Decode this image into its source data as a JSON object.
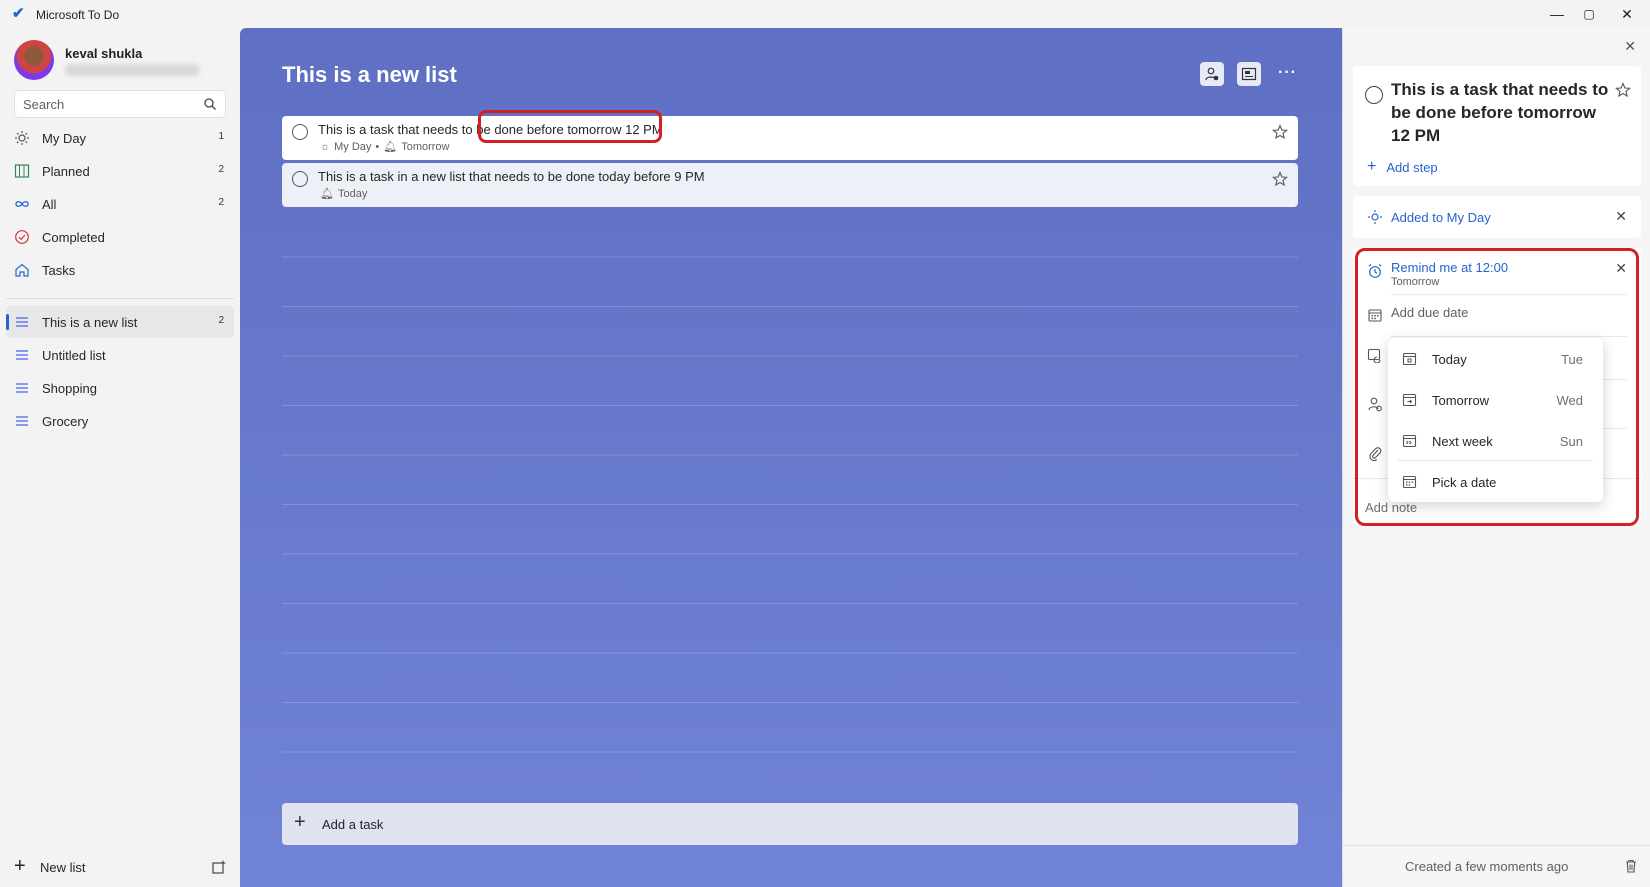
{
  "window": {
    "title": "Microsoft To Do",
    "minimize": "—",
    "maximize": "▢",
    "close": "✕"
  },
  "sidebar": {
    "user_name": "keval shukla",
    "search_placeholder": "Search",
    "items": [
      {
        "label": "My Day",
        "count": "1",
        "icon": "sun-icon"
      },
      {
        "label": "Planned",
        "count": "2",
        "icon": "calendar-grid-icon"
      },
      {
        "label": "All",
        "count": "2",
        "icon": "infinity-icon"
      },
      {
        "label": "Completed",
        "count": "",
        "icon": "check-circle-icon"
      },
      {
        "label": "Tasks",
        "count": "",
        "icon": "home-icon"
      },
      {
        "label": "This is a new list",
        "count": "2",
        "icon": "list-icon",
        "active": true
      },
      {
        "label": "Untitled list",
        "count": "",
        "icon": "list-icon"
      },
      {
        "label": "Shopping",
        "count": "",
        "icon": "list-icon"
      },
      {
        "label": "Grocery",
        "count": "",
        "icon": "list-icon"
      }
    ],
    "new_list_label": "New list"
  },
  "main": {
    "title": "This is a new list",
    "more": "···",
    "tasks": [
      {
        "title": "This is a task that needs to be done before tomorrow 12 PM",
        "meta_myday": "My Day",
        "meta_sep": "•",
        "meta_reminder": "Tomorrow"
      },
      {
        "title": "This is a task in a new list that needs to be done today before 9 PM",
        "meta_reminder": "Today"
      }
    ],
    "add_task_label": "Add a task"
  },
  "detail": {
    "close": "✕",
    "task_title": "This is a task that needs to be done before tomorrow 12 PM",
    "add_step": "Add step",
    "added_to_my_day": "Added to My Day",
    "reminder_title": "Remind me at 12:00",
    "reminder_sub": "Tomorrow",
    "add_due_date": "Add due date",
    "add_note": "Add note",
    "created": "Created a few moments ago",
    "due_menu": [
      {
        "label": "Today",
        "day": "Tue"
      },
      {
        "label": "Tomorrow",
        "day": "Wed"
      },
      {
        "label": "Next week",
        "day": "Sun"
      },
      {
        "label": "Pick a date",
        "day": ""
      }
    ]
  },
  "colors": {
    "accent": "#2564cf",
    "list_bg": "#6b7ccf",
    "annotation": "#d32020"
  }
}
